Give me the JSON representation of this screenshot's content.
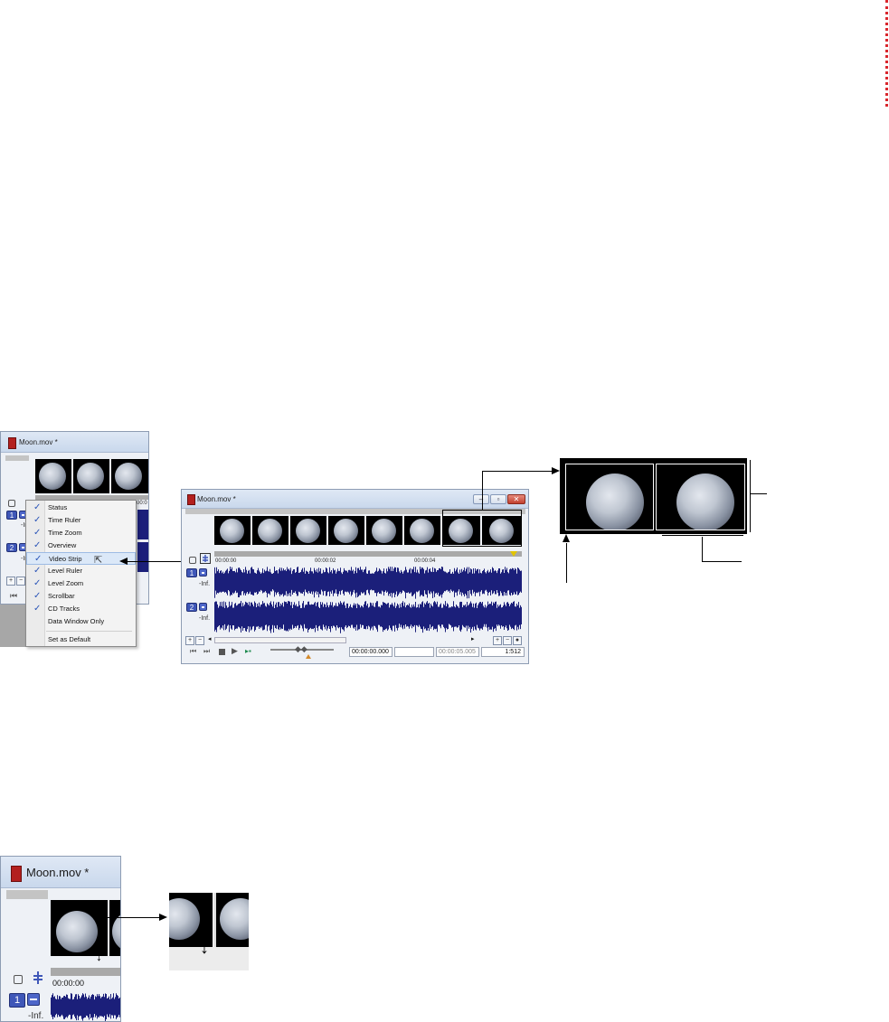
{
  "window": {
    "title": "Moon.mov *"
  },
  "context_menu": {
    "items": [
      {
        "label": "Status",
        "checked": true
      },
      {
        "label": "Time Ruler",
        "checked": true
      },
      {
        "label": "Time Zoom",
        "checked": true
      },
      {
        "label": "Overview",
        "checked": true
      },
      {
        "label": "Video Strip",
        "checked": true,
        "highlighted": true
      },
      {
        "label": "Level Ruler",
        "checked": true
      },
      {
        "label": "Level Zoom",
        "checked": true
      },
      {
        "label": "Scrollbar",
        "checked": true
      },
      {
        "label": "CD Tracks",
        "checked": true
      },
      {
        "label": "Data Window Only",
        "checked": false
      },
      {
        "label": "Set as Default",
        "checked": false
      }
    ]
  },
  "tracks": [
    {
      "number": "1",
      "level": "-Inf."
    },
    {
      "number": "2",
      "level": "-Inf."
    }
  ],
  "ruler": {
    "marks": [
      "00:00:00",
      "00:00:02",
      "00:00:04"
    ],
    "partial_mark": "00:0"
  },
  "status": {
    "cursor_position": "00:00:00.000",
    "length": "00:00:05.005",
    "zoom": "1:512"
  },
  "icons": {
    "lock": "lock-icon",
    "track_view": "track-view-icon",
    "resize": "vertical-resize-cursor-icon"
  },
  "colors": {
    "waveform": "#1b1f7a",
    "track_button": "#3f57b8",
    "marker": "#d9262c"
  }
}
